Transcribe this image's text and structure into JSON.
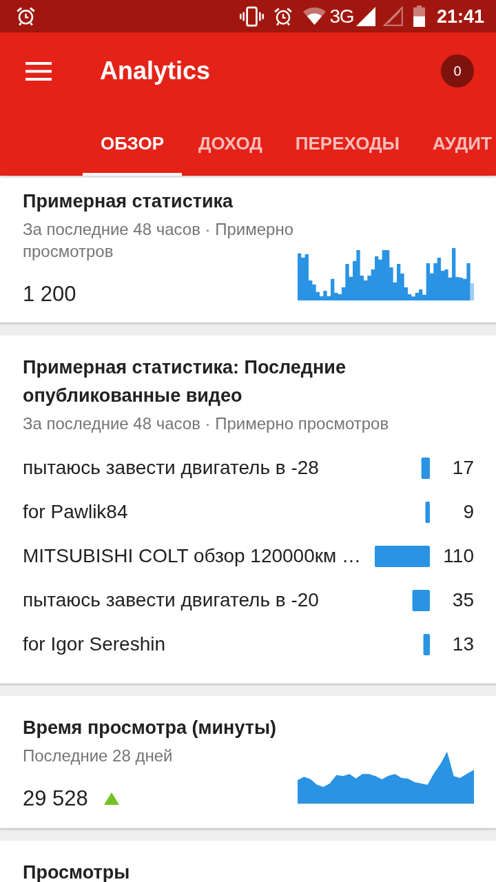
{
  "status_bar": {
    "network": "3G",
    "time": "21:41"
  },
  "app_bar": {
    "title": "Analytics",
    "badge": "0"
  },
  "tabs": [
    {
      "label": "ОБЗОР",
      "selected": true
    },
    {
      "label": "ДОХОД",
      "selected": false
    },
    {
      "label": "ПЕРЕХОДЫ",
      "selected": false
    },
    {
      "label": "АУДИТ",
      "selected": false
    }
  ],
  "cards": [
    {
      "kind": "bar_sparkline",
      "title": "Примерная статистика",
      "subtitle": "За последние 48 часов · Примерно просмотров",
      "value": "1 200"
    },
    {
      "kind": "video_list",
      "title": "Примерная статистика: Последние опубликованные видео",
      "subtitle": "За последние 48 часов · Примерно просмотров",
      "chart_data": {
        "type": "bar",
        "orientation": "horizontal",
        "categories": [
          "пытаюсь завести двигатель в -28",
          "for Pawlik84",
          "MITSUBISHI COLT обзор 120000км …",
          "пытаюсь завести двигатель в -20",
          "for Igor Sereshin"
        ],
        "values": [
          17,
          9,
          110,
          35,
          13
        ],
        "data_labels": true
      }
    },
    {
      "kind": "area_sparkline",
      "title": "Время просмотра (минуты)",
      "subtitle": "Последние 28 дней",
      "value": "29 528",
      "trend_up": true
    },
    {
      "kind": "plain",
      "title": "Просмотры"
    }
  ]
}
